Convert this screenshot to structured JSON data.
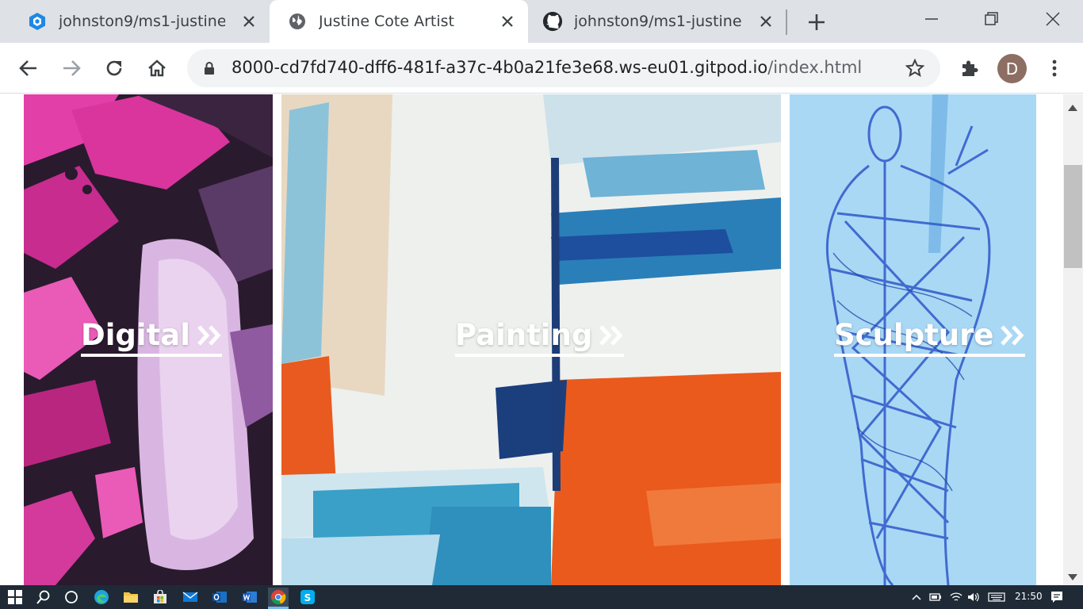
{
  "browser": {
    "tabs": [
      {
        "title": "johnston9/ms1-justine -",
        "icon": "gitpod-icon",
        "active": false
      },
      {
        "title": "Justine Cote Artist",
        "icon": "globe-icon",
        "active": true
      },
      {
        "title": "johnston9/ms1-justine",
        "icon": "github-icon",
        "active": false
      }
    ],
    "url_host": "8000-cd7fd740-dff6-481f-a37c-4b0a21fe3e68.ws-eu01.gitpod.io",
    "url_path": "/index.html",
    "profile_initial": "D"
  },
  "page": {
    "categories": [
      {
        "label": "Digital",
        "icon": "double-chevron-right-icon"
      },
      {
        "label": "Painting",
        "icon": "double-chevron-right-icon"
      },
      {
        "label": "Sculpture",
        "icon": "double-chevron-right-icon"
      }
    ]
  },
  "taskbar": {
    "apps": [
      "start-icon",
      "search-icon",
      "task-view-icon",
      "edge-icon",
      "file-explorer-icon",
      "store-icon",
      "mail-icon",
      "outlook-icon",
      "word-icon",
      "chrome-icon",
      "skype-icon"
    ],
    "time": "21:50"
  },
  "colors": {
    "tabstrip_bg": "#dee1e6",
    "taskbar_bg": "#1f2a36",
    "link_text": "#ffffff"
  }
}
